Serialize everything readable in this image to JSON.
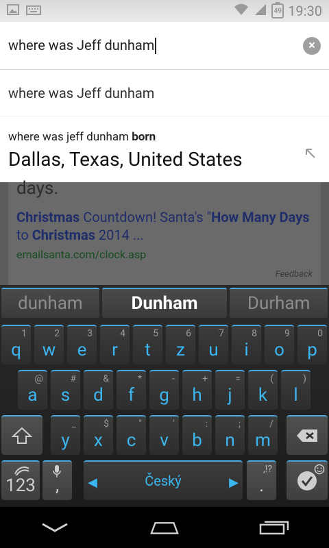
{
  "status_bar": {
    "time": "19:30",
    "battery": "49"
  },
  "search": {
    "query": "where was Jeff dunham"
  },
  "suggestions": {
    "plain": "where was Jeff dunham",
    "rich": {
      "query_prefix": "where was jeff dunham ",
      "query_bold": "born",
      "answer": "Dallas, Texas, United States"
    }
  },
  "page": {
    "days": "days.",
    "title_p1": "Christmas",
    "title_p2": " Countdown! Santa's \"",
    "title_p3": "How Many Days",
    "title_p4": " to ",
    "title_p5": "Christmas",
    "title_p6": " 2014 ...",
    "url": "emailsanta.com/clock.asp",
    "feedback": "Feedback"
  },
  "keyboard": {
    "predictions": [
      "dunham",
      "Dunham",
      "Durham"
    ],
    "row1": [
      {
        "k": "q",
        "s": "1"
      },
      {
        "k": "w",
        "s": "2"
      },
      {
        "k": "e",
        "s": "3"
      },
      {
        "k": "r",
        "s": "4"
      },
      {
        "k": "t",
        "s": "5"
      },
      {
        "k": "z",
        "s": "6"
      },
      {
        "k": "u",
        "s": "7"
      },
      {
        "k": "i",
        "s": "8"
      },
      {
        "k": "o",
        "s": "9"
      },
      {
        "k": "p",
        "s": "0"
      }
    ],
    "row2": [
      {
        "k": "a",
        "s": "@"
      },
      {
        "k": "s",
        "s": "#"
      },
      {
        "k": "d",
        "s": "&"
      },
      {
        "k": "f",
        "s": "*"
      },
      {
        "k": "g",
        "s": "-"
      },
      {
        "k": "h",
        "s": "+"
      },
      {
        "k": "j",
        "s": "="
      },
      {
        "k": "k",
        "s": "("
      },
      {
        "k": "l",
        "s": ")"
      }
    ],
    "row3": [
      {
        "k": "y",
        "s": "_"
      },
      {
        "k": "x",
        "s": "$"
      },
      {
        "k": "c",
        "s": "\""
      },
      {
        "k": "v",
        "s": "'"
      },
      {
        "k": "b",
        "s": ":"
      },
      {
        "k": "n",
        "s": ";"
      },
      {
        "k": "m",
        "s": "/"
      }
    ],
    "row4": {
      "numbers": "123",
      "comma": ",",
      "space_label": "Český",
      "period": ".",
      "period_sup": ",!?"
    }
  }
}
